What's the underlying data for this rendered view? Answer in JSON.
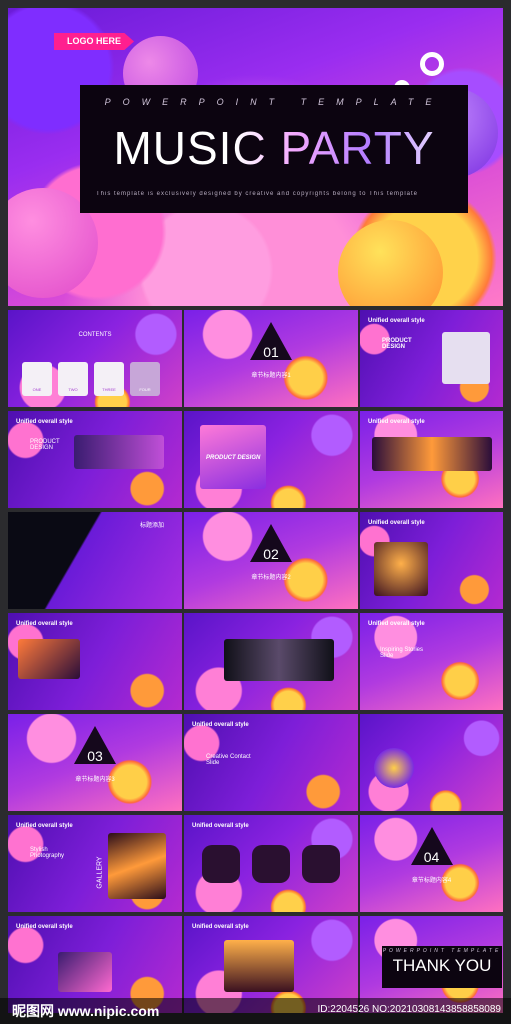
{
  "hero": {
    "logo_label": "LOGO HERE",
    "template_label": "POWERPOINT TEMPLATE",
    "title": "MUSIC PARTY",
    "subtitle": "This template is exclusively designed by creative and copyrights belong to This template"
  },
  "slides": {
    "contents": "CONTENTS",
    "cards": [
      "ONE",
      "TWO",
      "THREE",
      "FOUR"
    ],
    "sections": [
      {
        "num": "01",
        "label": "章节标题内容1"
      },
      {
        "num": "02",
        "label": "章节标题内容2"
      },
      {
        "num": "03",
        "label": "章节标题内容3"
      },
      {
        "num": "04",
        "label": "章节标题内容4"
      }
    ],
    "brand": "Unified overall style",
    "product_design": "PRODUCT DESIGN",
    "product_design_caps": "PRODUCT DESIGN",
    "heading_add": "标题添加",
    "inspiring": "Inspiring Stories Slide",
    "creative_contact": "Creative Contact Slide",
    "stylish": "Stylish Photography",
    "gallery": "GALLERY",
    "thank_you": "THANK YOU",
    "pp_small": "POWERPOINT TEMPLATE"
  },
  "watermark": {
    "site": "昵图网 www.nipic.com",
    "id_text": "ID:2204526 NO:20210308143858858089"
  },
  "colors": {
    "accent_pink": "#ff1f8f",
    "purple": "#8a22e0",
    "dark": "#0c0410"
  }
}
